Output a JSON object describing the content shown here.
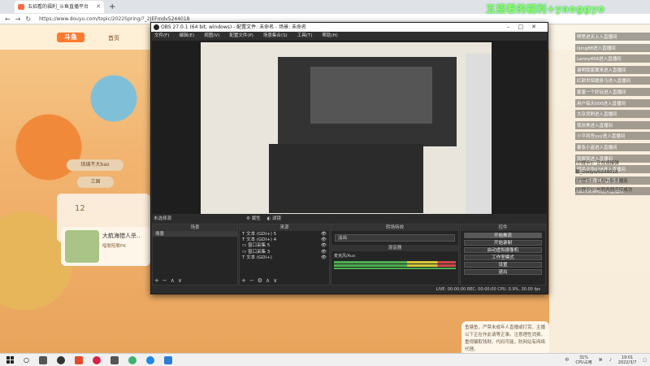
{
  "browser": {
    "tab_title": "五招看的福利_斗鱼直播平台",
    "url": "https://www.douyu.com/topic/2022Spring/?_2JEFmdv5244018"
  },
  "site": {
    "logo": "斗鱼",
    "home": "首页",
    "left_buttons": [
      "琉璃不大bao",
      "三国",
      "12",
      "大航海猎人杀..."
    ],
    "card_title": "大航海猎人杀..",
    "card_sub": "唱歌陪聊PK",
    "overlay_title": "五招看的福利+yaoggyo",
    "danmaku": [
      "明思进天上入直播间",
      "lijing88进入直播间",
      "Lenny456进入直播间",
      "谢明我家属来进入直播间",
      "红颜世保缓身马进入直播间",
      "蒙唐一个好玩进入直播间",
      "用户每天000进入直播间",
      "大杂货刷进入直播间",
      "我欣美进入直播间",
      "小平尚吾yyy进入直播间",
      "春急小盗进入直播间",
      "我靓我进入直播间",
      "明晶夕华028进入直播间",
      "ranie七月进入直播间",
      "UZMShen6进入直播间"
    ],
    "system_msgs": [
      "[小提示]：正在连接弹",
      "幕_Douyu/5244018",
      "[小提示]：正在与服务器连",
      "[小提示]：与服务器连接成功"
    ],
    "bottom_card": "鱼塘鱼，严禁未成年人直播或打赏，主播以下正在作此请等正事。注意理性消费。重视骗取钱财。代码可能，防网站有网络代理。"
  },
  "obs": {
    "title": "OBS 27.0.1 (64 bit, windows) - 配置文件: 未命名 - 场景: 未命名",
    "menu": [
      "文件(F)",
      "编辑(E)",
      "视图(V)",
      "配置文件(P)",
      "场景集合(S)",
      "工具(T)",
      "帮助(H)"
    ],
    "source_bar_left": "未选择源",
    "source_bar_mid_1": "属性",
    "source_bar_mid_2": "滤镜",
    "docks": {
      "scenes_label": "场景",
      "scene_items": [
        "场景"
      ],
      "sources_label": "来源",
      "source_items": [
        "文本 (GDI+) 5",
        "文本 (GDI+) 4",
        "窗口采集 5",
        "窗口采集 3",
        "文本 (GDI+)"
      ],
      "mixer_label": "混音器",
      "mixer_channel": "麦克风/Aux",
      "transitions_label": "转场特效",
      "transition_value": "淡出",
      "controls_label": "控件",
      "controls": [
        "开始推流",
        "开始录制",
        "启动虚拟摄像机",
        "工作室模式",
        "设置",
        "退出"
      ]
    },
    "status": "LIVE: 00:00:00   REC: 00:00:00   CPU: 0.9%, 30.00 fps"
  },
  "taskbar": {
    "cpu": "31%",
    "cpu_label": "CPU占用",
    "time": "19:01",
    "date": "2022/3/7",
    "ime": "中"
  }
}
